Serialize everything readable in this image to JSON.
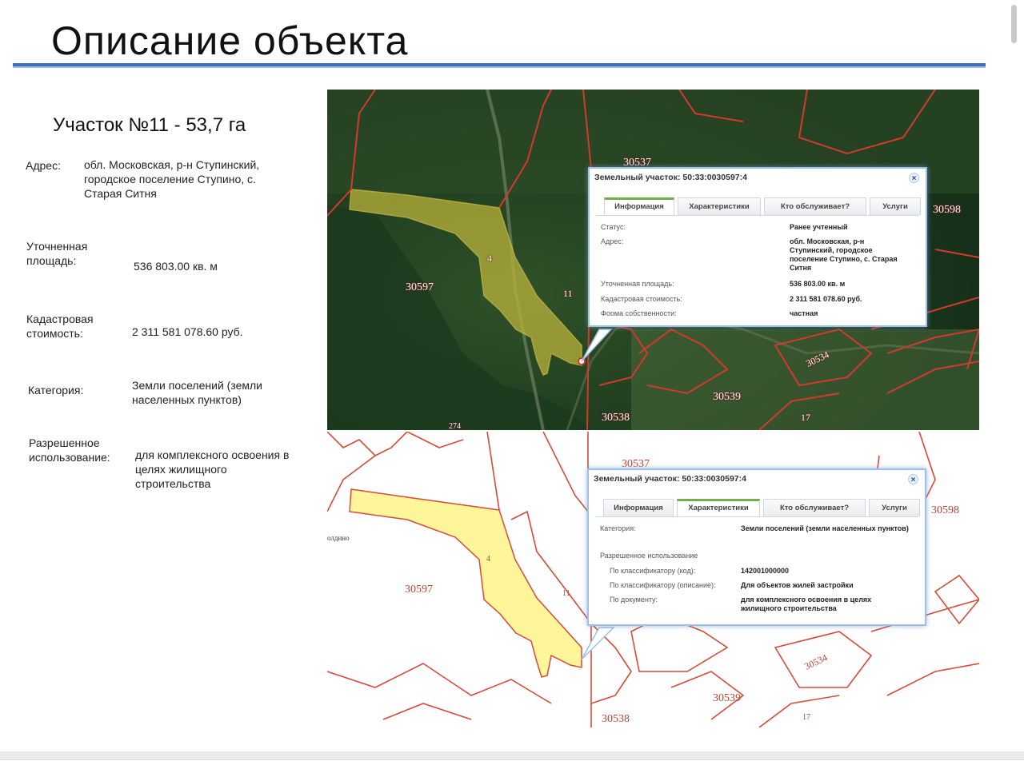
{
  "slide": {
    "title": "Описание объекта",
    "plot_title": "Участок №11 - 53,7 га",
    "fields": [
      {
        "label": "Адрес:",
        "value": "обл. Московская, р-н Ступинский, городское поселение Ступино, с. Старая Ситня"
      },
      {
        "label": "Уточненная площадь:",
        "value": "536 803.00 кв. м"
      },
      {
        "label": "Кадастровая стоимость:",
        "value": "2 311 581 078.60 руб."
      },
      {
        "label": "Категория:",
        "value": "Земли поселений (земли населенных пунктов)"
      },
      {
        "label": "Разрешенное использование:",
        "value": "для комплексного освоения в целях жилищного строительства"
      }
    ]
  },
  "popup1": {
    "title": "Земельный участок: 50:33:0030597:4",
    "close": "×",
    "tabs": [
      "Информация",
      "Характеристики",
      "Кто обслуживает?",
      "Услуги"
    ],
    "active_tab": "Информация",
    "rows": [
      {
        "label": "Статус:",
        "value": "Ранее учтенный"
      },
      {
        "label": "Адрес:",
        "value": "обл. Московская, р-н Ступинский, городское поселение Ступино, с. Старая Ситня"
      },
      {
        "label": "Уточненная площадь:",
        "value": "536 803.00 кв. м"
      },
      {
        "label": "Кадастровая стоимость:",
        "value": "2 311 581 078.60 руб."
      },
      {
        "label": "Форма собственности:",
        "value": "частная"
      }
    ]
  },
  "popup2": {
    "title": "Земельный участок: 50:33:0030597:4",
    "close": "×",
    "tabs": [
      "Информация",
      "Характеристики",
      "Кто обслуживает?",
      "Услуги"
    ],
    "active_tab": "Характеристики",
    "rows": [
      {
        "label": "Категория:",
        "value": "Земли поселений (земли населенных пунктов)"
      },
      {
        "label": "Разрешенное использование",
        "value": ""
      },
      {
        "label": "По классификатору (код):",
        "value": "142001000000"
      },
      {
        "label": "По классификатору (описание):",
        "value": "Для объектов жилей застройки"
      },
      {
        "label": "По документу:",
        "value": "для комплексного освоения в целях жилищного строительства"
      }
    ]
  },
  "map_sat_labels": [
    "30537",
    "30597",
    "4",
    "11",
    "30598",
    "30534",
    "30539",
    "30538",
    "17",
    "274"
  ],
  "map_vec_labels": [
    "30537",
    "30597",
    "4",
    "11",
    "30598",
    "30534",
    "30539",
    "30538",
    "17",
    "олдино"
  ],
  "colors": {
    "accent_blue": "#3d6fc0",
    "parcel_line": "#d84a35",
    "parcel_fill": "#fff59b",
    "popup_border": "#9cc0e6",
    "active_tab": "#6fb04a"
  }
}
